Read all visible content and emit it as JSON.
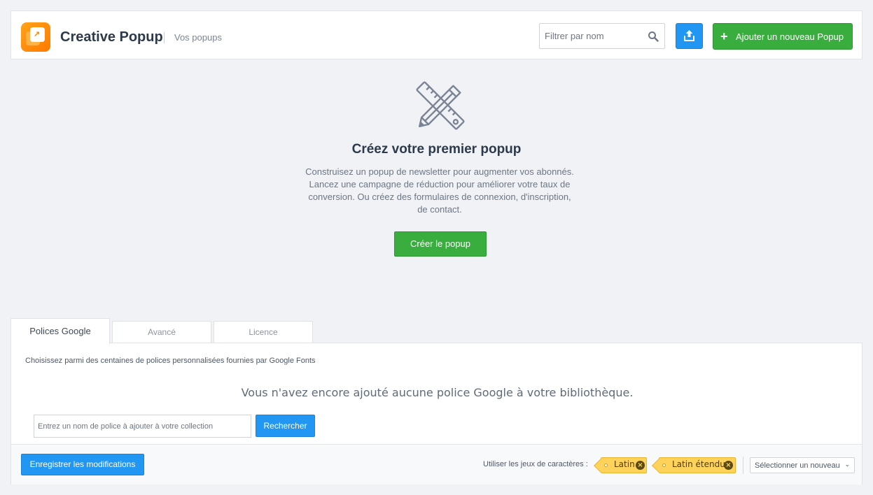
{
  "header": {
    "app_title": "Creative Popup",
    "breadcrumb": "Vos popups",
    "search_placeholder": "Filtrer par nom",
    "add_button_label": "Ajouter un nouveau Popup",
    "add_button_icon": "plus-icon",
    "upload_button_icon": "upload-icon"
  },
  "empty_state": {
    "icon": "ruler-pencil-icon",
    "title": "Créez votre premier popup",
    "description": "Construisez un popup de newsletter pour augmenter vos abonnés. Lancez une campagne de réduction pour améliorer votre taux de conversion. Ou créez des formulaires de connexion, d'inscription, de contact.",
    "create_button_label": "Créer le popup"
  },
  "tabs": [
    {
      "label": "Polices Google",
      "active": true
    },
    {
      "label": "Avancé",
      "active": false
    },
    {
      "label": "Licence",
      "active": false
    }
  ],
  "fonts_panel": {
    "intro": "Choisissez parmi des centaines de polices personnalisées fournies par Google Fonts",
    "empty_message": "Vous n'avez encore ajouté aucune police Google à votre bibliothèque.",
    "input_placeholder": "Entrez un nom de police à ajouter à votre collection",
    "search_button_label": "Rechercher"
  },
  "footer": {
    "save_button_label": "Enregistrer les modifications",
    "charset_label": "Utiliser les jeux de caractères :",
    "charsets": [
      "Latin",
      "Latin étendu"
    ],
    "charset_select_value": "Sélectionner un nouveau"
  },
  "colors": {
    "primary_blue": "#2196f3",
    "success_green": "#3aad3f",
    "tag_yellow": "#ffd35b",
    "logo_orange": "#ff8a00"
  }
}
